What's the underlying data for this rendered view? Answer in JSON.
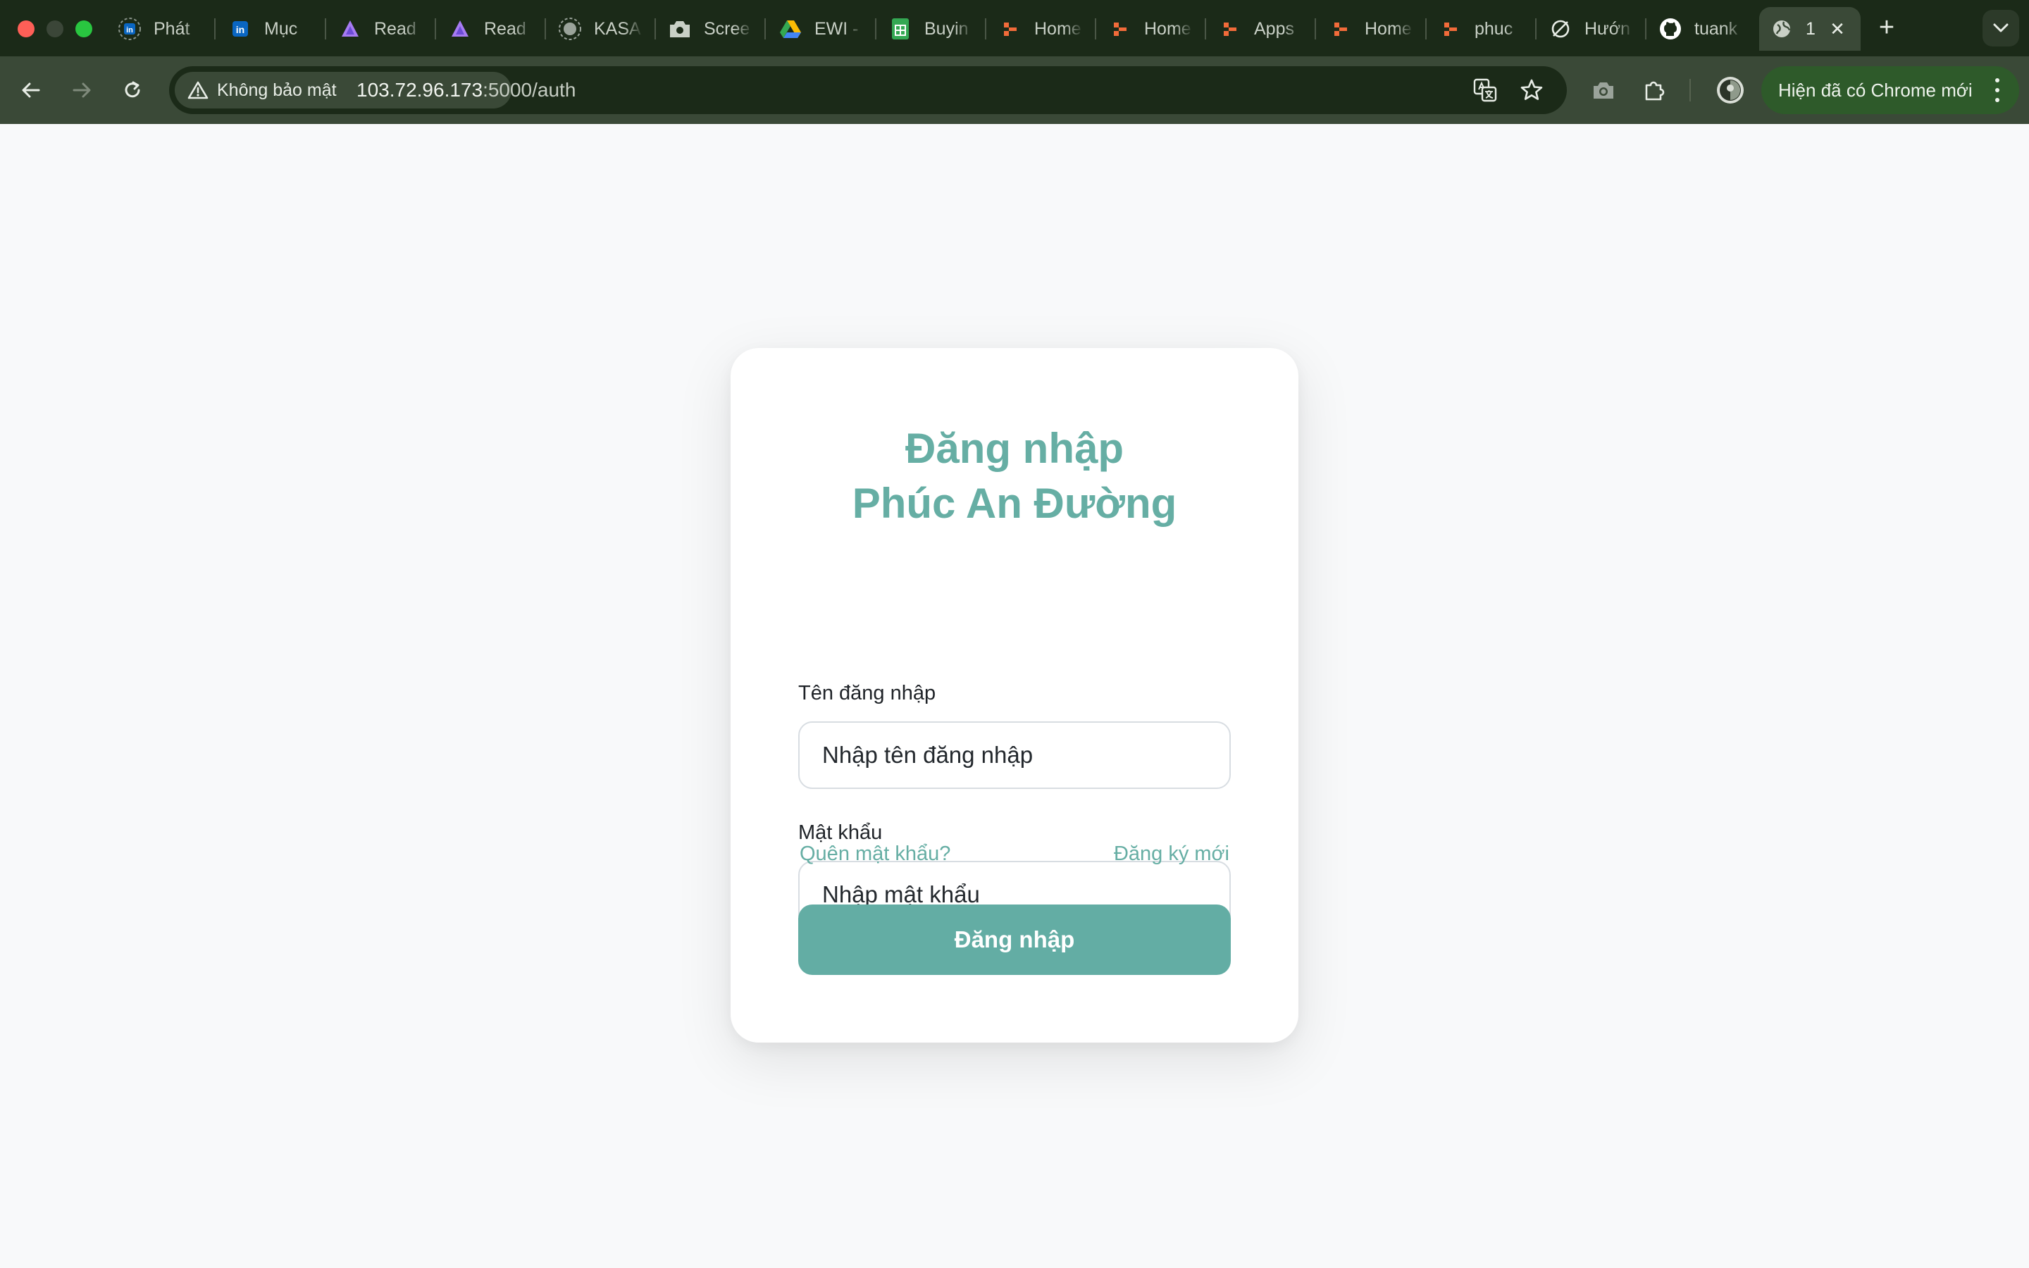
{
  "browser": {
    "tabs": [
      {
        "label": "Phát",
        "icon": "linkedin-badge-icon",
        "color": "#0a66c2"
      },
      {
        "label": "Mục",
        "icon": "linkedin-icon",
        "color": "#0a66c2"
      },
      {
        "label": "Read",
        "icon": "ai-assistant-icon",
        "color": "#a77bf3"
      },
      {
        "label": "Read",
        "icon": "ai-assistant-icon",
        "color": "#a77bf3"
      },
      {
        "label": "KASA",
        "icon": "globe-badge-icon",
        "color": "#9aa39a"
      },
      {
        "label": "Scree",
        "icon": "camera-icon",
        "color": "#c9d0c6"
      },
      {
        "label": "EWI -",
        "icon": "google-drive-icon",
        "color": "#34a853"
      },
      {
        "label": "Buyin",
        "icon": "google-sheets-icon",
        "color": "#34a853"
      },
      {
        "label": "Home",
        "icon": "app-logo-icon",
        "color": "#f26b3a"
      },
      {
        "label": "Home",
        "icon": "app-logo-icon",
        "color": "#f26b3a"
      },
      {
        "label": "Apps",
        "icon": "app-logo-icon",
        "color": "#f26b3a"
      },
      {
        "label": "Home",
        "icon": "app-logo-icon",
        "color": "#f26b3a"
      },
      {
        "label": "phuc",
        "icon": "app-logo-icon",
        "color": "#f26b3a"
      },
      {
        "label": "Hướn",
        "icon": "no-entry-icon",
        "color": "#e8ede6"
      },
      {
        "label": "tuank",
        "icon": "github-icon",
        "color": "#ffffff"
      }
    ],
    "active_tab": {
      "label": "1",
      "icon": "globe-icon"
    },
    "security_label": "Không bảo mật",
    "url_host": "103.72.96.173",
    "url_path": ":5000/auth",
    "update_label": "Hiện đã có Chrome mới"
  },
  "login": {
    "title_line1": "Đăng nhập",
    "title_line2": "Phúc An Đường",
    "username_label": "Tên đăng nhập",
    "username_placeholder": "Nhập tên đăng nhập",
    "username_value": "",
    "password_label": "Mật khẩu",
    "password_placeholder": "Nhập mật khẩu",
    "password_value": "",
    "forgot_link": "Quên mật khẩu?",
    "register_link": "Đăng ký mới",
    "submit_label": "Đăng nhập"
  },
  "colors": {
    "accent": "#63ada4",
    "chrome_bg": "#1b2a18",
    "toolbar_bg": "#3a4937",
    "page_bg": "#f8f9fa"
  }
}
